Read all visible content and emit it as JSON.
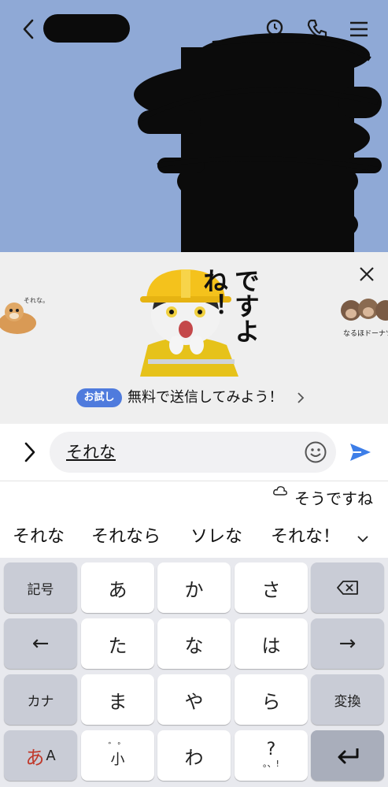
{
  "header": {
    "back_icon": "chevron-left-icon",
    "search_icon": "search-icon",
    "call_icon": "phone-icon",
    "menu_icon": "hamburger-menu-icon"
  },
  "sticker_panel": {
    "close_icon": "close-icon",
    "left_sticker_caption": "それな。",
    "main_sticker_text": "ですよね！",
    "right_sticker_caption": "なるほドーナツ",
    "trial_badge": "お試し",
    "trial_text": "無料で送信してみよう！"
  },
  "input": {
    "expand_icon": "chevron-right-icon",
    "value": "それな",
    "emoji_icon": "smiley-icon",
    "send_icon": "send-icon"
  },
  "predictions": {
    "cloud_icon": "cloud-icon",
    "cloud_suggestion": "そうですね",
    "candidates": [
      "それな",
      "それなら",
      "ソレな",
      "それな！"
    ],
    "more_icon": "chevron-down-icon"
  },
  "keyboard": {
    "row1": [
      "記号",
      "あ",
      "か",
      "さ"
    ],
    "row2": [
      "←",
      "た",
      "な",
      "は",
      "→"
    ],
    "row3": [
      "カナ",
      "ま",
      "や",
      "ら",
      "変換"
    ],
    "row4_mode": {
      "main": "あ",
      "sub": "A"
    },
    "row4_small": {
      "top": "゛゜",
      "bottom": "小"
    },
    "row4_wa": "わ",
    "row4_punct": {
      "top": "?",
      "bottom": "。、!"
    }
  }
}
